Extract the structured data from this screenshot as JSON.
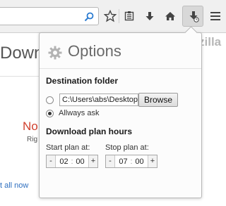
{
  "toolbar": {
    "icons": [
      "search-icon",
      "star-icon",
      "reading-list-icon",
      "download-icon",
      "home-icon",
      "download-plan-icon",
      "menu-icon"
    ]
  },
  "background": {
    "frag_down": "Down",
    "frag_zilla": "zilla",
    "frag_no": "No",
    "frag_righ": "Rig",
    "frag_clear": "t all now"
  },
  "panel": {
    "title": "Options",
    "destination_title": "Destination folder",
    "path_value": "C:\\Users\\abs\\Desktop",
    "browse_label": "Browse",
    "always_ask_label": "Allways ask",
    "plan_title": "Download plan hours",
    "start_label": "Start plan at:",
    "stop_label": "Stop plan at:",
    "start_hour": "02",
    "start_minute": "00",
    "stop_hour": "07",
    "stop_minute": "00",
    "minus": "-",
    "plus": "+",
    "colon": ":"
  }
}
